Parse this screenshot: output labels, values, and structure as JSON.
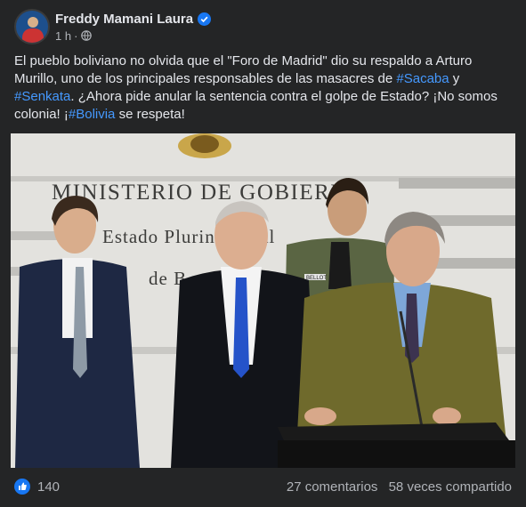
{
  "post": {
    "author": "Freddy Mamani Laura",
    "time": "1 h",
    "separator": "·",
    "text_parts": [
      "El pueblo boliviano no olvida que el \"Foro de Madrid\" dio su respaldo a Arturo Murillo, uno de los principales responsables de las masacres de ",
      "#Sacaba",
      " y ",
      "#Senkata",
      ". ¿Ahora pide anular la sentencia contra el golpe de Estado? ¡No somos colonia! ¡",
      "#Bolivia",
      " se respeta!"
    ],
    "photo": {
      "sign_line1": "MINISTERIO DE GOBIERNO",
      "sign_line2": "Estado Plurinacional",
      "sign_line3": "de B",
      "name_tag": "BELLOT"
    }
  },
  "footer": {
    "reactions": "140",
    "comments": "27 comentarios",
    "shares": "58 veces compartido"
  },
  "colors": {
    "background": "#242526",
    "text": "#e4e6eb",
    "secondary": "#b0b3b8",
    "hashtag": "#4599ff",
    "verified": "#1877f2"
  }
}
